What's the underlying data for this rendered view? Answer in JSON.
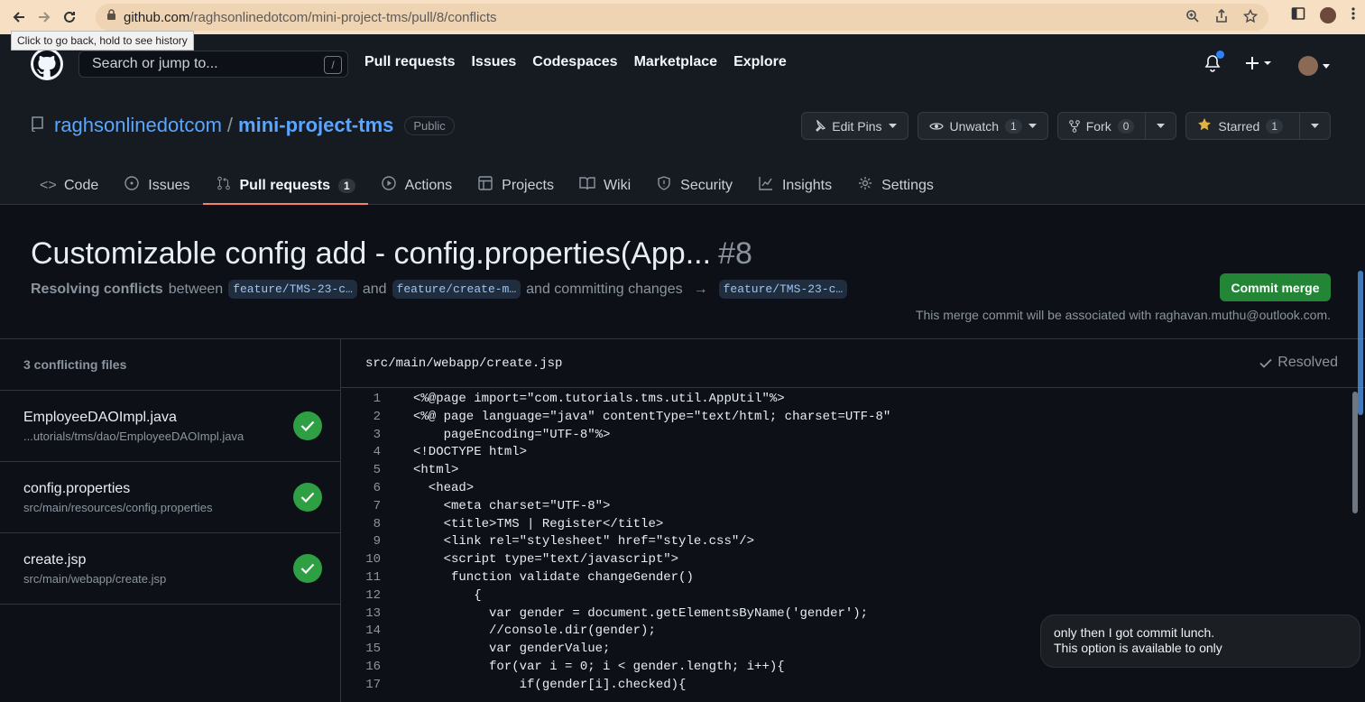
{
  "browser": {
    "url_host": "github.com",
    "url_path": "/raghsonlinedotcom/mini-project-tms/pull/8/conflicts",
    "tooltip": "Click to go back, hold to see history"
  },
  "header": {
    "search_placeholder": "Search or jump to...",
    "search_shortcut": "/",
    "nav": [
      "Pull requests",
      "Issues",
      "Codespaces",
      "Marketplace",
      "Explore"
    ]
  },
  "repo": {
    "owner": "raghsonlinedotcom",
    "separator": "/",
    "name": "mini-project-tms",
    "visibility": "Public",
    "edit_pins": "Edit Pins",
    "unwatch": "Unwatch",
    "unwatch_count": "1",
    "fork": "Fork",
    "fork_count": "0",
    "starred": "Starred",
    "star_count": "1"
  },
  "tabs": [
    {
      "label": "Code",
      "icon": "code-icon"
    },
    {
      "label": "Issues",
      "icon": "issue-icon"
    },
    {
      "label": "Pull requests",
      "icon": "pull-request-icon",
      "count": "1",
      "active": true
    },
    {
      "label": "Actions",
      "icon": "play-icon"
    },
    {
      "label": "Projects",
      "icon": "table-icon"
    },
    {
      "label": "Wiki",
      "icon": "book-icon"
    },
    {
      "label": "Security",
      "icon": "shield-icon"
    },
    {
      "label": "Insights",
      "icon": "graph-icon"
    },
    {
      "label": "Settings",
      "icon": "gear-icon"
    }
  ],
  "pr": {
    "title": "Customizable config add - config.properties(App...",
    "number": "#8",
    "resolving": "Resolving conflicts",
    "between": "between",
    "branch_a": "feature/TMS-23-c…",
    "and": "and",
    "branch_b": "feature/create-m…",
    "committing": "and committing changes",
    "arrow": "→",
    "branch_target": "feature/TMS-23-c…",
    "commit_button": "Commit merge",
    "merge_note": "This merge commit will be associated with raghavan.muthu@outlook.com."
  },
  "files": {
    "count_label": "3 conflicting files",
    "items": [
      {
        "name": "EmployeeDAOImpl.java",
        "path": "...utorials/tms/dao/EmployeeDAOImpl.java"
      },
      {
        "name": "config.properties",
        "path": "src/main/resources/config.properties"
      },
      {
        "name": "create.jsp",
        "path": "src/main/webapp/create.jsp"
      }
    ]
  },
  "editor": {
    "path": "src/main/webapp/create.jsp",
    "status": "Resolved",
    "lines": [
      "<%@page import=\"com.tutorials.tms.util.AppUtil\"%>",
      "<%@ page language=\"java\" contentType=\"text/html; charset=UTF-8\"",
      "    pageEncoding=\"UTF-8\"%>",
      "<!DOCTYPE html>",
      "<html>",
      "  <head>",
      "    <meta charset=\"UTF-8\">",
      "    <title>TMS | Register</title>",
      "    <link rel=\"stylesheet\" href=\"style.css\"/>",
      "    <script type=\"text/javascript\">",
      "     function validate changeGender()",
      "        {",
      "          var gender = document.getElementsByName('gender');",
      "          //console.dir(gender);",
      "          var genderValue;",
      "          for(var i = 0; i < gender.length; i++){",
      "              if(gender[i].checked){"
    ]
  },
  "chat": {
    "line1": "only then I got commit lunch.",
    "line2": "This option is available to only"
  }
}
